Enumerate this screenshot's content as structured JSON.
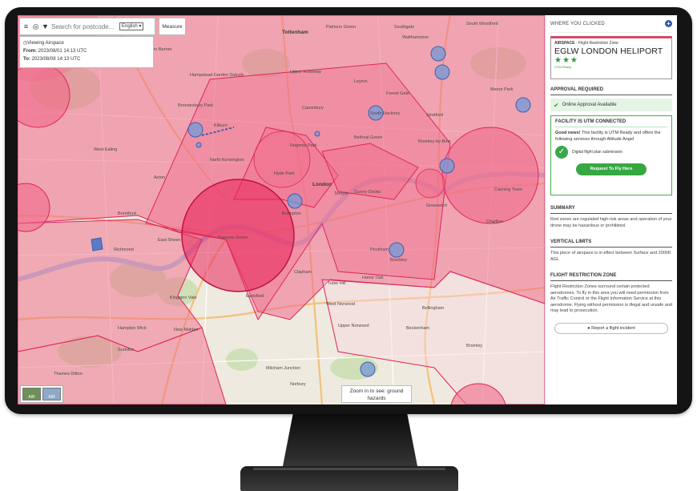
{
  "toolbar": {
    "search_placeholder": "Search for postcode...",
    "language": "English",
    "measure_label": "Measure"
  },
  "airspace_info": {
    "title": "Viewing Airspace",
    "from_label": "From:",
    "from_value": "2023/08/01 14:13 UTC",
    "to_label": "To:",
    "to_value": "2023/08/08 14:13 UTC"
  },
  "map": {
    "places": [
      {
        "name": "Southgate",
        "big": false
      },
      {
        "name": "Palmers Green",
        "big": false
      },
      {
        "name": "Tottenham",
        "big": true
      },
      {
        "name": "Walthamstow",
        "big": false
      },
      {
        "name": "South Woodford",
        "big": false
      },
      {
        "name": "Cockfosters",
        "big": false
      },
      {
        "name": "Friern Barnet",
        "big": false
      },
      {
        "name": "Hampstead Garden Suburb",
        "big": false
      },
      {
        "name": "Upper Holloway",
        "big": false
      },
      {
        "name": "Leyton",
        "big": false
      },
      {
        "name": "Forest Gate",
        "big": false
      },
      {
        "name": "Manor Park",
        "big": false
      },
      {
        "name": "Kilburn",
        "big": false
      },
      {
        "name": "Brondesbury Park",
        "big": false
      },
      {
        "name": "Canonbury",
        "big": false
      },
      {
        "name": "South Hackney",
        "big": false
      },
      {
        "name": "Stratford",
        "big": false
      },
      {
        "name": "West Ealing",
        "big": false
      },
      {
        "name": "North Kensington",
        "big": false
      },
      {
        "name": "Regents Park",
        "big": false
      },
      {
        "name": "Bethnal Green",
        "big": false
      },
      {
        "name": "Bromley-by-Bow",
        "big": false
      },
      {
        "name": "Acton",
        "big": false
      },
      {
        "name": "Hyde Park",
        "big": false
      },
      {
        "name": "London",
        "big": true
      },
      {
        "name": "Temple",
        "big": false
      },
      {
        "name": "Surrey Docks",
        "big": false
      },
      {
        "name": "Canning Town",
        "big": false
      },
      {
        "name": "Brentford",
        "big": false
      },
      {
        "name": "Brompton",
        "big": false
      },
      {
        "name": "Greenwich",
        "big": false
      },
      {
        "name": "Charlton",
        "big": false
      },
      {
        "name": "Parsons Green",
        "big": false
      },
      {
        "name": "East Sheen",
        "big": false
      },
      {
        "name": "Peckham",
        "big": false
      },
      {
        "name": "Richmond",
        "big": false
      },
      {
        "name": "Clapham",
        "big": false
      },
      {
        "name": "Brockley",
        "big": false
      },
      {
        "name": "Earlsfield",
        "big": false
      },
      {
        "name": "Honor Oak",
        "big": false
      },
      {
        "name": "Kingston Vale",
        "big": false
      },
      {
        "name": "Tulse Hill",
        "big": false
      },
      {
        "name": "West Norwood",
        "big": false
      },
      {
        "name": "Bellingham",
        "big": false
      },
      {
        "name": "Hampton Wick",
        "big": false
      },
      {
        "name": "New Malden",
        "big": false
      },
      {
        "name": "Upper Norwood",
        "big": false
      },
      {
        "name": "Beckenham",
        "big": false
      },
      {
        "name": "Bromley",
        "big": false
      },
      {
        "name": "Surbiton",
        "big": false
      },
      {
        "name": "Thames Ditton",
        "big": false
      },
      {
        "name": "Mitcham Junction",
        "big": false
      },
      {
        "name": "Norbury",
        "big": false
      }
    ],
    "layer_labels": [
      "AIR",
      "AIR"
    ],
    "zoom_hint": "Zoom in to see: ground hazards",
    "colors": {
      "zone_fill": "#f06a8a",
      "zone_stroke": "#e0245a",
      "circle_fill": "#e8235a",
      "marker": "#7a98d6"
    }
  },
  "sidebar": {
    "header": "WHERE YOU CLICKED",
    "plus_icon": "+",
    "zone": {
      "type_label": "AIRSPACE",
      "type_value": "Flight Restriction Zone",
      "name": "EGLW LONDON HELIPORT",
      "stars": "★★★",
      "sub": "UTM Ready"
    },
    "approval": {
      "title": "APPROVAL REQUIRED",
      "tick": "✔",
      "text": "Online Approval Available"
    },
    "utm": {
      "title": "FACILITY IS UTM CONNECTED",
      "lead": "Good news!",
      "text": " This facility is UTM Ready and offers the following services through Altitude Angel",
      "service": "Digital flight plan submission",
      "check": "✓",
      "button": "Request To Fly Here"
    },
    "summary": {
      "title": "SUMMARY",
      "text": "Red zones are regulated high-risk areas and operation of your drone may be hazardous or prohibited."
    },
    "vertical": {
      "title": "VERTICAL LIMITS",
      "text": "This piece of airspace is in effect between Surface and 2000ft AGL"
    },
    "frz": {
      "title": "FLIGHT RESTRICTION ZONE",
      "text": "Flight Restriction Zones surround certain protected aerodromes. To fly in this area you will need permission from Air Traffic Control or the Flight Information Service at this aerodrome. Flying without permission is illegal and unsafe and may lead to prosecution."
    },
    "report": {
      "icon": "●",
      "label": "Report a flight incident"
    }
  }
}
